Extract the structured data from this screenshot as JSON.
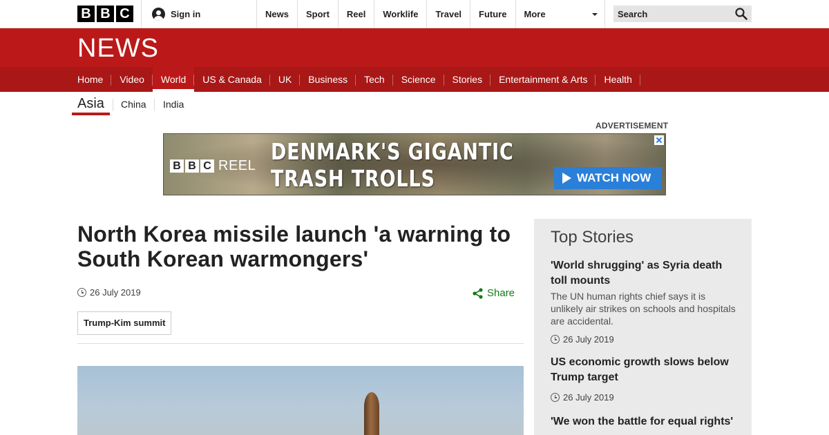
{
  "topbar": {
    "logo_letters": [
      "B",
      "B",
      "C"
    ],
    "signin_label": "Sign in",
    "nav": [
      "News",
      "Sport",
      "Reel",
      "Worklife",
      "Travel",
      "Future",
      "More"
    ],
    "search_placeholder": "Search"
  },
  "news_header": {
    "title": "NEWS"
  },
  "section_nav": {
    "items": [
      "Home",
      "Video",
      "World",
      "US & Canada",
      "UK",
      "Business",
      "Tech",
      "Science",
      "Stories",
      "Entertainment & Arts",
      "Health"
    ],
    "active": "World"
  },
  "sub_nav": {
    "active": "Asia",
    "items": [
      "China",
      "India"
    ]
  },
  "ad": {
    "label": "ADVERTISEMENT",
    "brand_letters": [
      "B",
      "B",
      "C"
    ],
    "brand_product": "REEL",
    "headline_line1": "DENMARK'S GIGANTIC",
    "headline_line2": "TRASH TROLLS",
    "cta": "WATCH NOW"
  },
  "article": {
    "title": "North Korea missile launch 'a warning to South Korean warmongers'",
    "date": "26 July 2019",
    "share_label": "Share",
    "tag": "Trump-Kim summit"
  },
  "sidebar": {
    "heading": "Top Stories",
    "stories": [
      {
        "title": "'World shrugging' as Syria death toll mounts",
        "summary": "The UN human rights chief says it is unlikely air strikes on schools and hospitals are accidental.",
        "date": "26 July 2019"
      },
      {
        "title": "US economic growth slows below Trump target",
        "summary": "",
        "date": "26 July 2019"
      },
      {
        "title": "'We won the battle for equal rights'",
        "summary": "",
        "date": ""
      }
    ]
  },
  "colors": {
    "brand_red": "#bb1919",
    "nav_red": "#a91717",
    "share_green": "#147a14",
    "cta_blue": "#2a7fd8"
  }
}
